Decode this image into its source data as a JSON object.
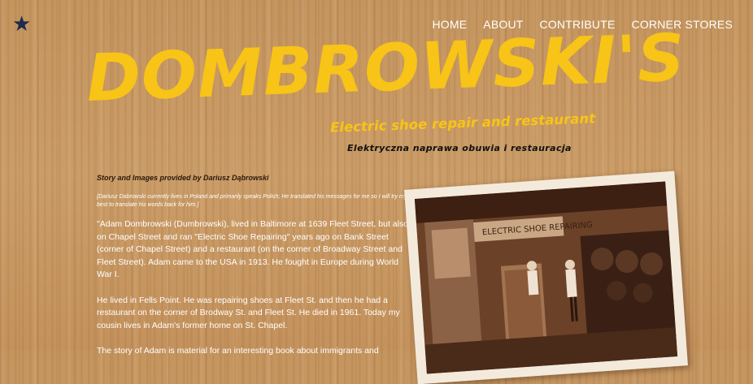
{
  "nav": {
    "items": [
      {
        "label": "HOME"
      },
      {
        "label": "ABOUT"
      },
      {
        "label": "CONTRIBUTE"
      },
      {
        "label": "CORNER STORES"
      }
    ]
  },
  "icons": {
    "logo": "star-icon"
  },
  "colors": {
    "title": "#f7c417",
    "star": "#1f2a4d",
    "background": "#c89a64"
  },
  "hero": {
    "title": "DOMBROWSKI'S",
    "subtitle": "Electric shoe repair and restaurant",
    "polish": "Elektryczna naprawa obuwia i restauracja"
  },
  "article": {
    "credit": "Story and Images provided by Dariusz Dąbrowski",
    "note": "[Dariusz Dabrowski currently lives in Poland and primarily speaks Polish; He translated his messages for me so I will try my best to translate his words back for him.]",
    "paragraphs": [
      "\"Adam Dombrowski (Dumbrowski), lived in Baltimore at 1639 Fleet Street, but also on Chapel Street and ran \"Electric Shoe Repairing\" years ago on Bank Street (corner of Chapel Street) and a restaurant (on the corner of Broadway Street and Fleet Street). Adam came to the USA in 1913. He fought in Europe during World War I.",
      "He lived in Fells Point. He was repairing shoes at Fleet St. and then he had a restaurant on the corner of Brodway St. and Fleet St. He died in 1961. Today my cousin lives in Adam's former home on St. Chapel.",
      "The story of Adam is material for an interesting book about immigrants and"
    ]
  },
  "photo": {
    "sign": "ELECTRIC SHOE REPAIRING"
  }
}
